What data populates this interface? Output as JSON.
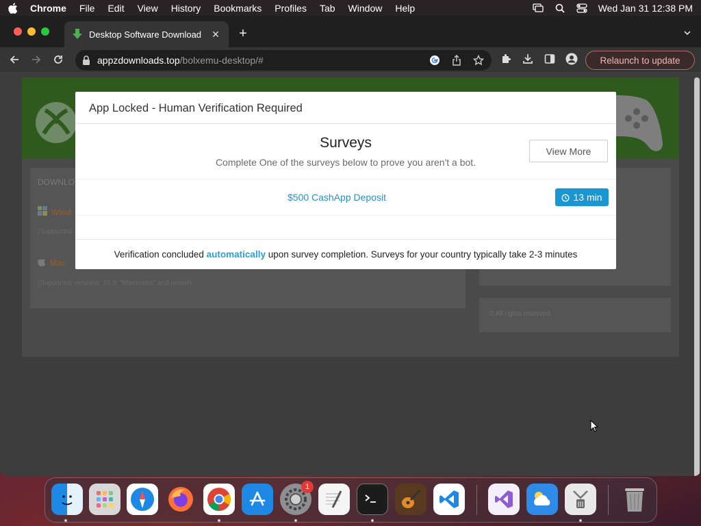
{
  "menubar": {
    "app_name": "Chrome",
    "items": [
      "File",
      "Edit",
      "View",
      "History",
      "Bookmarks",
      "Profiles",
      "Tab",
      "Window",
      "Help"
    ],
    "clock": "Wed Jan 31  12:38 PM"
  },
  "browser": {
    "tab_title": "Desktop Software Download",
    "url_host": "appzdownloads.top",
    "url_path": "/bolxemu-desktop/#",
    "relaunch_label": "Relaunch to update"
  },
  "page": {
    "download_heading": "DOWNLO",
    "windows_link": "Wind",
    "windows_supported": "(Supported",
    "mac_link": "Mac",
    "mac_supported": "(Supported versions: 10.9: \"Mavericks\" and newer)",
    "footer": "© All rights reserved."
  },
  "modal": {
    "header": "App Locked - Human Verification Required",
    "title": "Surveys",
    "subtitle": "Complete One of the surveys below to prove you aren't a bot.",
    "view_more_label": "View More",
    "surveys": [
      {
        "label": "$500 CashApp Deposit",
        "time": "13 min"
      }
    ],
    "footer_before": "Verification concluded ",
    "footer_highlight": "automatically",
    "footer_after": " upon survey completion. Surveys for your country typically take 2-3 minutes"
  },
  "dock": {
    "settings_badge": "1",
    "apps": [
      "finder-icon",
      "launchpad-icon",
      "safari-icon",
      "firefox-icon",
      "chrome-icon",
      "app-store-icon",
      "system-settings-icon",
      "textedit-icon",
      "terminal-icon",
      "garageband-icon",
      "vscode-icon",
      "visual-studio-icon",
      "weather-icon",
      "archive-utility-icon",
      "trash-icon"
    ]
  }
}
